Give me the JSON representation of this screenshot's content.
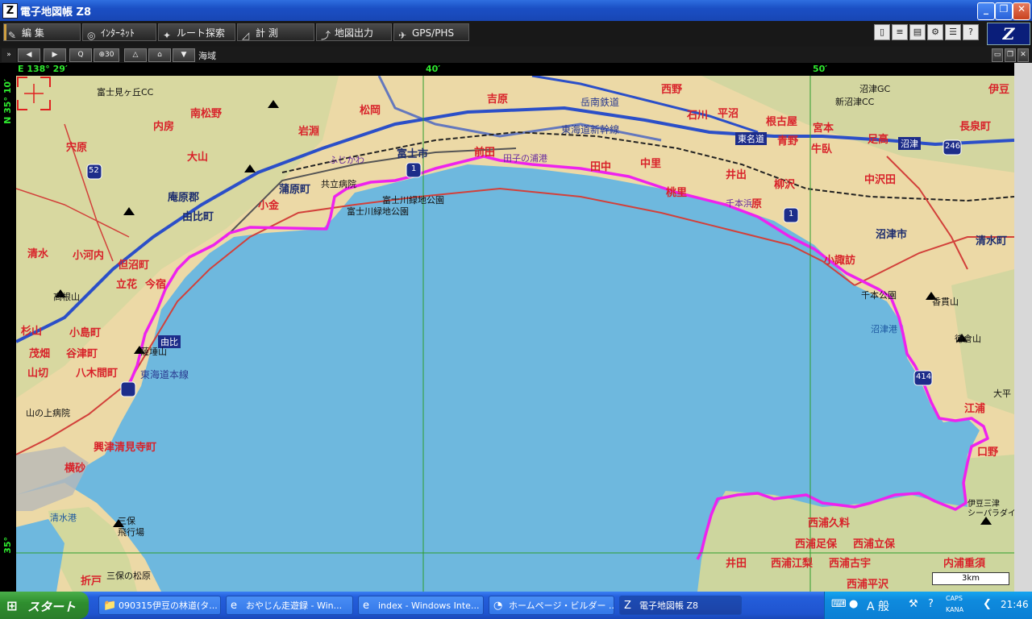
{
  "window": {
    "title": "電子地図帳 Z8",
    "controls": {
      "minimize": "_",
      "restore": "❐",
      "close": "✕"
    }
  },
  "toolbar": {
    "buttons": [
      {
        "label": "編 集",
        "icon": "✎"
      },
      {
        "label": "ｲﾝﾀｰﾈｯﾄ",
        "icon": "◎"
      },
      {
        "label": "ルート探索",
        "icon": "✦"
      },
      {
        "label": "計 測",
        "icon": "◿"
      },
      {
        "label": "地図出力",
        "icon": "⤴"
      },
      {
        "label": "GPS/PHS",
        "icon": "✈"
      }
    ],
    "logo": "Z"
  },
  "navbar": {
    "buttons": [
      "◀",
      "▶",
      "Q",
      "⊕30",
      "△",
      "⌂",
      "▼"
    ],
    "layer_label": "海域"
  },
  "coords": {
    "lon_start": "E 138° 29′",
    "lon_40": "40′",
    "lon_50": "50′",
    "lat_top": "N 35° 10′",
    "lat_bottom": "35°"
  },
  "map": {
    "scale_label": "3km",
    "labels": {
      "fujimi_cc": "富士見ヶ丘CC",
      "nishino": "西野",
      "ishikawa": "石川",
      "hiranuma": "平沼",
      "numazu_gc": "沼津GC",
      "shintsuda_cc": "新沼津CC",
      "izu_nagaoka": "伊豆",
      "minamimatsuno": "南松野",
      "uchibo": "内房",
      "iwabuchi": "岩淵",
      "matsuoka": "松岡",
      "yoshiwara": "吉原",
      "kokanzan": "岳南鉄道",
      "tokaido_shinkansen": "東海道新幹線",
      "tomei": "東名道",
      "nezukoya": "根古屋",
      "miyamoto": "宮本",
      "aonoya": "青野",
      "ashitaka": "足高",
      "ushibuse": "牛臥",
      "numazu_ic": "沼津",
      "chonaga": "長泉町",
      "shishido": "宍原",
      "oyama": "大山",
      "fuji_city": "富士市",
      "maeda": "前田",
      "tanaka": "田中",
      "nakazato": "中里",
      "ide": "井出",
      "yanagisawa": "柳沢",
      "nakasawada": "中沢田",
      "tokaido_main": "東海道本線",
      "ihara_gun": "庵原郡",
      "yui_cho": "由比町",
      "kambara": "蒲原町",
      "fujikawa_park": "富士川緑地公園",
      "momozato": "桃里",
      "hara": "原",
      "numazu_city": "沼津市",
      "shimizu_cho": "清水町",
      "kyoritsu_hosp": "共立病院",
      "koganezawa": "小金",
      "shimizu_higashi": "清水",
      "kogochi": "小河内",
      "tadamachi": "但沼町",
      "tachibana": "立花",
      "imajuku": "今宿",
      "ko_suwa": "小諏訪",
      "chihon_park": "千本公園",
      "kanukiyama": "香貫山",
      "takanezan": "高根山",
      "sugiyama": "杉山",
      "kojima": "小島町",
      "yui": "由比",
      "satta": "薩埵山",
      "mobata": "茂畑",
      "yatsu": "谷津町",
      "yamakiri": "山切",
      "yagi": "八木間町",
      "numazu_port": "沼津港",
      "tokurayama": "徳倉山",
      "taihei": "大平",
      "egura": "江浦",
      "yamanoue": "山の上病院",
      "okitsu": "興津清見寺町",
      "yokosuna": "横砂",
      "kuchino": "口野",
      "shimizu_port": "清水港",
      "miho_airfield": "三保\n飛行場",
      "izumi_mitsu": "伊豆三津\nシーパラダイス",
      "kyoto_hosp": "西浦久料",
      "nishiura_ashiho": "西浦足保",
      "nishiura_tateho": "西浦立保",
      "ida": "井田",
      "nishiura_ena": "西浦江梨",
      "nishiura_kou": "西浦古宇",
      "uchiura_shige": "内浦重須",
      "nishiura_hirasawa": "西浦平沢",
      "miho_matsubara": "三保の松原",
      "orito": "折戸",
      "fuji_gawa": "ふじかわ",
      "chigo": "千本浜",
      "tagonoura": "田子の浦港",
      "fujigawa_park2": "富士川緑地公園",
      "r1a": "1",
      "r1b": "1",
      "r52": "52",
      "r246": "246",
      "r414": "414"
    }
  },
  "taskbar": {
    "start": "スタート",
    "tasks": [
      {
        "label": "090315伊豆の林道(タ...",
        "icon": "📁"
      },
      {
        "label": "おやじん走遊録 - Win...",
        "icon": "e"
      },
      {
        "label": "index - Windows Inte...",
        "icon": "e"
      },
      {
        "label": "ホームページ・ビルダー ...",
        "icon": "◔"
      },
      {
        "label": "電子地図帳 Z8",
        "icon": "Z"
      }
    ],
    "tray": {
      "ime": "A 般",
      "caps": "CAPS",
      "kana": "KANA",
      "time": "21:46"
    }
  }
}
